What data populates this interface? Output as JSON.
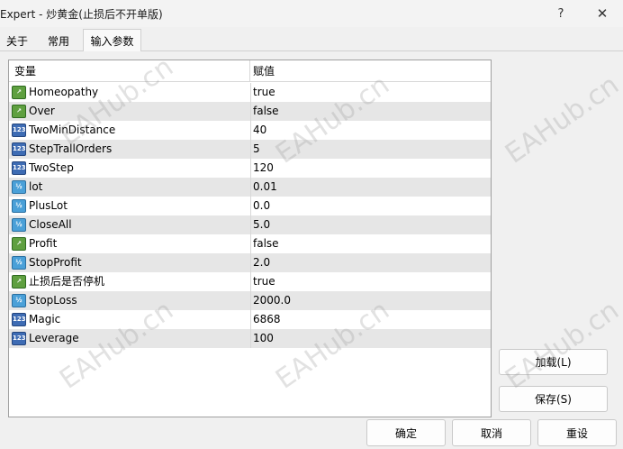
{
  "window": {
    "title": "Expert - 炒黄金(止损后不开单版)",
    "help_glyph": "?",
    "close_glyph": "✕"
  },
  "tabs": [
    {
      "label": "关于"
    },
    {
      "label": "常用"
    },
    {
      "label": "输入参数",
      "active": true
    }
  ],
  "grid": {
    "header": {
      "variable": "变量",
      "value": "赋值"
    },
    "rows": [
      {
        "type": "bool",
        "icon": "bool-param-icon",
        "name": "Homeopathy",
        "value": "true"
      },
      {
        "type": "bool",
        "icon": "bool-param-icon",
        "name": "Over",
        "value": "false"
      },
      {
        "type": "int",
        "icon": "int-param-icon",
        "name": "TwoMinDistance",
        "value": "40"
      },
      {
        "type": "int",
        "icon": "int-param-icon",
        "name": "StepTrallOrders",
        "value": "5"
      },
      {
        "type": "int",
        "icon": "int-param-icon",
        "name": "TwoStep",
        "value": "120"
      },
      {
        "type": "dbl",
        "icon": "double-param-icon",
        "name": "lot",
        "value": "0.01"
      },
      {
        "type": "dbl",
        "icon": "double-param-icon",
        "name": "PlusLot",
        "value": "0.0"
      },
      {
        "type": "dbl",
        "icon": "double-param-icon",
        "name": "CloseAll",
        "value": "5.0"
      },
      {
        "type": "bool",
        "icon": "bool-param-icon",
        "name": "Profit",
        "value": "false"
      },
      {
        "type": "dbl",
        "icon": "double-param-icon",
        "name": "StopProfit",
        "value": "2.0"
      },
      {
        "type": "bool",
        "icon": "bool-param-icon",
        "name": "止损后是否停机",
        "value": "true"
      },
      {
        "type": "dbl",
        "icon": "double-param-icon",
        "name": "StopLoss",
        "value": "2000.0"
      },
      {
        "type": "int",
        "icon": "int-param-icon",
        "name": "Magic",
        "value": "6868"
      },
      {
        "type": "int",
        "icon": "int-param-icon",
        "name": "Leverage",
        "value": "100"
      }
    ]
  },
  "buttons": {
    "load": "加载(L)",
    "save": "保存(S)",
    "ok": "确定",
    "cancel": "取消",
    "reset": "重设"
  },
  "watermark": "EAHub.cn"
}
